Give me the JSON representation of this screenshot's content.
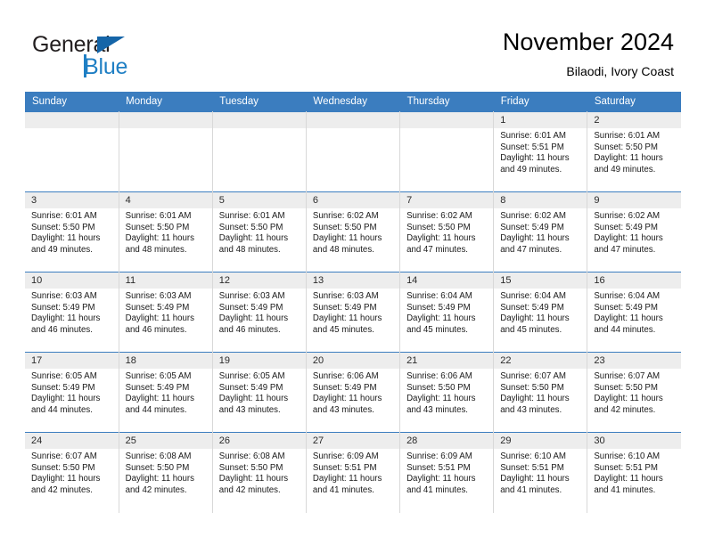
{
  "brand": {
    "name_top": "General",
    "name_bottom": "Blue",
    "accent_color": "#1f7fc4",
    "triangle_color": "#1565a8"
  },
  "header": {
    "title": "November 2024",
    "subtitle": "Bilaodi, Ivory Coast"
  },
  "calendar": {
    "header_bg": "#3b7dbf",
    "daynum_bg": "#ededed",
    "weekday_headers": [
      "Sunday",
      "Monday",
      "Tuesday",
      "Wednesday",
      "Thursday",
      "Friday",
      "Saturday"
    ],
    "labels": {
      "sunrise": "Sunrise:",
      "sunset": "Sunset:",
      "daylight": "Daylight:"
    },
    "weeks": [
      [
        {
          "day": "",
          "empty": true
        },
        {
          "day": "",
          "empty": true
        },
        {
          "day": "",
          "empty": true
        },
        {
          "day": "",
          "empty": true
        },
        {
          "day": "",
          "empty": true
        },
        {
          "day": "1",
          "sunrise": "Sunrise: 6:01 AM",
          "sunset": "Sunset: 5:51 PM",
          "daylight": "Daylight: 11 hours and 49 minutes."
        },
        {
          "day": "2",
          "sunrise": "Sunrise: 6:01 AM",
          "sunset": "Sunset: 5:50 PM",
          "daylight": "Daylight: 11 hours and 49 minutes."
        }
      ],
      [
        {
          "day": "3",
          "sunrise": "Sunrise: 6:01 AM",
          "sunset": "Sunset: 5:50 PM",
          "daylight": "Daylight: 11 hours and 49 minutes."
        },
        {
          "day": "4",
          "sunrise": "Sunrise: 6:01 AM",
          "sunset": "Sunset: 5:50 PM",
          "daylight": "Daylight: 11 hours and 48 minutes."
        },
        {
          "day": "5",
          "sunrise": "Sunrise: 6:01 AM",
          "sunset": "Sunset: 5:50 PM",
          "daylight": "Daylight: 11 hours and 48 minutes."
        },
        {
          "day": "6",
          "sunrise": "Sunrise: 6:02 AM",
          "sunset": "Sunset: 5:50 PM",
          "daylight": "Daylight: 11 hours and 48 minutes."
        },
        {
          "day": "7",
          "sunrise": "Sunrise: 6:02 AM",
          "sunset": "Sunset: 5:50 PM",
          "daylight": "Daylight: 11 hours and 47 minutes."
        },
        {
          "day": "8",
          "sunrise": "Sunrise: 6:02 AM",
          "sunset": "Sunset: 5:49 PM",
          "daylight": "Daylight: 11 hours and 47 minutes."
        },
        {
          "day": "9",
          "sunrise": "Sunrise: 6:02 AM",
          "sunset": "Sunset: 5:49 PM",
          "daylight": "Daylight: 11 hours and 47 minutes."
        }
      ],
      [
        {
          "day": "10",
          "sunrise": "Sunrise: 6:03 AM",
          "sunset": "Sunset: 5:49 PM",
          "daylight": "Daylight: 11 hours and 46 minutes."
        },
        {
          "day": "11",
          "sunrise": "Sunrise: 6:03 AM",
          "sunset": "Sunset: 5:49 PM",
          "daylight": "Daylight: 11 hours and 46 minutes."
        },
        {
          "day": "12",
          "sunrise": "Sunrise: 6:03 AM",
          "sunset": "Sunset: 5:49 PM",
          "daylight": "Daylight: 11 hours and 46 minutes."
        },
        {
          "day": "13",
          "sunrise": "Sunrise: 6:03 AM",
          "sunset": "Sunset: 5:49 PM",
          "daylight": "Daylight: 11 hours and 45 minutes."
        },
        {
          "day": "14",
          "sunrise": "Sunrise: 6:04 AM",
          "sunset": "Sunset: 5:49 PM",
          "daylight": "Daylight: 11 hours and 45 minutes."
        },
        {
          "day": "15",
          "sunrise": "Sunrise: 6:04 AM",
          "sunset": "Sunset: 5:49 PM",
          "daylight": "Daylight: 11 hours and 45 minutes."
        },
        {
          "day": "16",
          "sunrise": "Sunrise: 6:04 AM",
          "sunset": "Sunset: 5:49 PM",
          "daylight": "Daylight: 11 hours and 44 minutes."
        }
      ],
      [
        {
          "day": "17",
          "sunrise": "Sunrise: 6:05 AM",
          "sunset": "Sunset: 5:49 PM",
          "daylight": "Daylight: 11 hours and 44 minutes."
        },
        {
          "day": "18",
          "sunrise": "Sunrise: 6:05 AM",
          "sunset": "Sunset: 5:49 PM",
          "daylight": "Daylight: 11 hours and 44 minutes."
        },
        {
          "day": "19",
          "sunrise": "Sunrise: 6:05 AM",
          "sunset": "Sunset: 5:49 PM",
          "daylight": "Daylight: 11 hours and 43 minutes."
        },
        {
          "day": "20",
          "sunrise": "Sunrise: 6:06 AM",
          "sunset": "Sunset: 5:49 PM",
          "daylight": "Daylight: 11 hours and 43 minutes."
        },
        {
          "day": "21",
          "sunrise": "Sunrise: 6:06 AM",
          "sunset": "Sunset: 5:50 PM",
          "daylight": "Daylight: 11 hours and 43 minutes."
        },
        {
          "day": "22",
          "sunrise": "Sunrise: 6:07 AM",
          "sunset": "Sunset: 5:50 PM",
          "daylight": "Daylight: 11 hours and 43 minutes."
        },
        {
          "day": "23",
          "sunrise": "Sunrise: 6:07 AM",
          "sunset": "Sunset: 5:50 PM",
          "daylight": "Daylight: 11 hours and 42 minutes."
        }
      ],
      [
        {
          "day": "24",
          "sunrise": "Sunrise: 6:07 AM",
          "sunset": "Sunset: 5:50 PM",
          "daylight": "Daylight: 11 hours and 42 minutes."
        },
        {
          "day": "25",
          "sunrise": "Sunrise: 6:08 AM",
          "sunset": "Sunset: 5:50 PM",
          "daylight": "Daylight: 11 hours and 42 minutes."
        },
        {
          "day": "26",
          "sunrise": "Sunrise: 6:08 AM",
          "sunset": "Sunset: 5:50 PM",
          "daylight": "Daylight: 11 hours and 42 minutes."
        },
        {
          "day": "27",
          "sunrise": "Sunrise: 6:09 AM",
          "sunset": "Sunset: 5:51 PM",
          "daylight": "Daylight: 11 hours and 41 minutes."
        },
        {
          "day": "28",
          "sunrise": "Sunrise: 6:09 AM",
          "sunset": "Sunset: 5:51 PM",
          "daylight": "Daylight: 11 hours and 41 minutes."
        },
        {
          "day": "29",
          "sunrise": "Sunrise: 6:10 AM",
          "sunset": "Sunset: 5:51 PM",
          "daylight": "Daylight: 11 hours and 41 minutes."
        },
        {
          "day": "30",
          "sunrise": "Sunrise: 6:10 AM",
          "sunset": "Sunset: 5:51 PM",
          "daylight": "Daylight: 11 hours and 41 minutes."
        }
      ]
    ]
  }
}
